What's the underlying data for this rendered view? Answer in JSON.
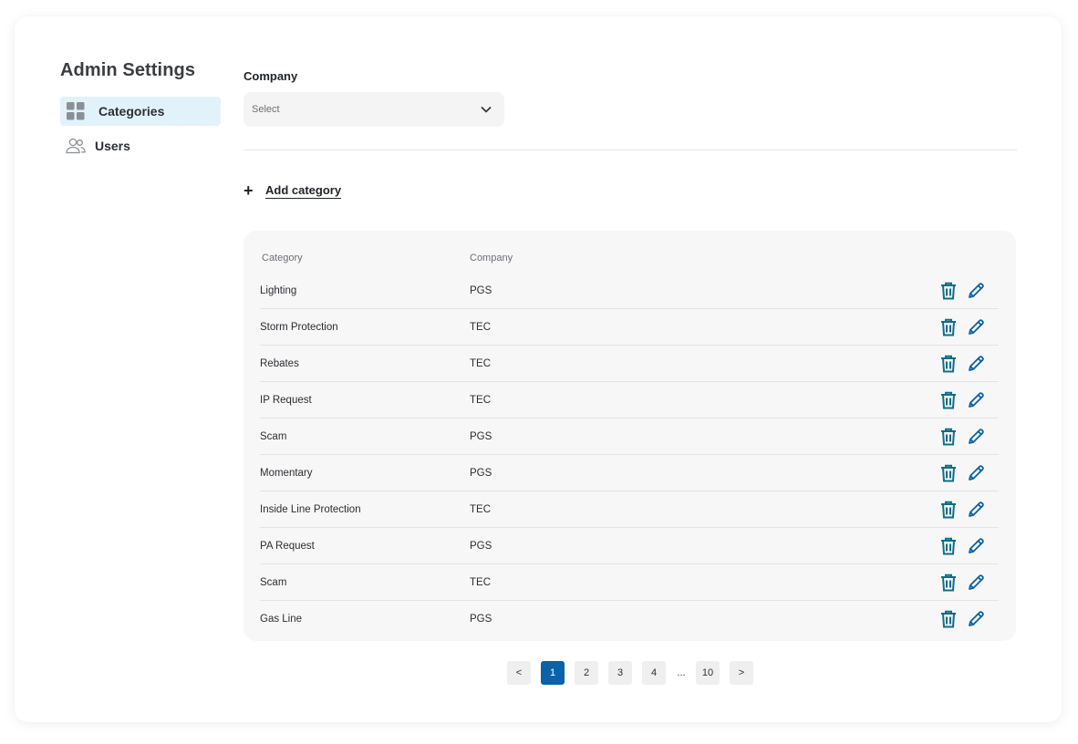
{
  "sidebar": {
    "title": "Admin Settings",
    "items": [
      {
        "label": "Categories",
        "icon": "grid-icon",
        "active": true
      },
      {
        "label": "Users",
        "icon": "users-icon",
        "active": false
      }
    ]
  },
  "filter": {
    "label": "Company",
    "select_placeholder": "Select"
  },
  "actions": {
    "add_category_label": "Add category"
  },
  "table": {
    "columns": [
      "Category",
      "Company"
    ],
    "rows": [
      {
        "category": "Lighting",
        "company": "PGS"
      },
      {
        "category": "Storm Protection",
        "company": "TEC"
      },
      {
        "category": "Rebates",
        "company": "TEC"
      },
      {
        "category": "IP Request",
        "company": "TEC"
      },
      {
        "category": "Scam",
        "company": "PGS"
      },
      {
        "category": "Momentary",
        "company": "PGS"
      },
      {
        "category": "Inside Line Protection",
        "company": "TEC"
      },
      {
        "category": "PA Request",
        "company": "PGS"
      },
      {
        "category": "Scam",
        "company": "TEC"
      },
      {
        "category": "Gas Line",
        "company": "PGS"
      }
    ]
  },
  "pagination": {
    "prev": "<",
    "pages": [
      "1",
      "2",
      "3",
      "4"
    ],
    "ellipsis": "...",
    "last": "10",
    "next": ">",
    "current": "1"
  },
  "colors": {
    "accent": "#0a62a9",
    "icon_teal": "#0d6e8a",
    "active_nav_bg": "#e2f2fb"
  }
}
